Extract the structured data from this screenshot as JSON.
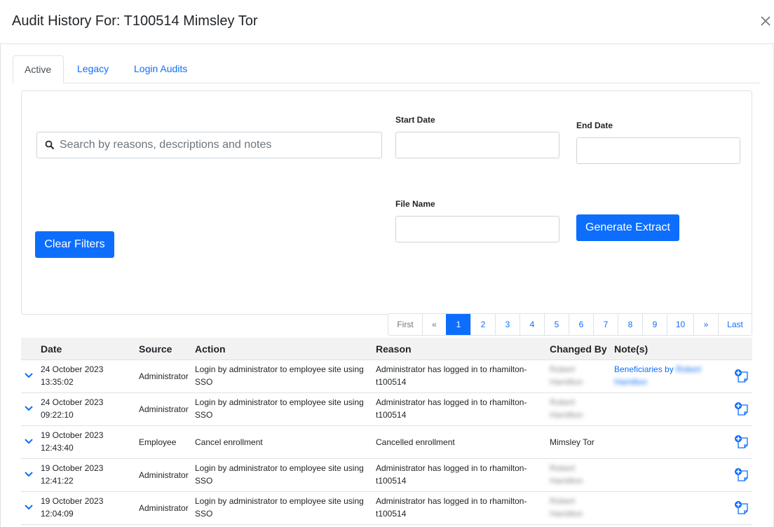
{
  "modal": {
    "title": "Audit History For: T100514 Mimsley Tor",
    "close_label": "×"
  },
  "tabs": [
    {
      "label": "Active",
      "active": true
    },
    {
      "label": "Legacy",
      "active": false
    },
    {
      "label": "Login Audits",
      "active": false
    }
  ],
  "filters": {
    "search_placeholder": "Search by reasons, descriptions and notes",
    "search_value": "",
    "start_date_label": "Start Date",
    "start_date_value": "",
    "end_date_label": "End Date",
    "end_date_value": "",
    "file_name_label": "File Name",
    "file_name_value": "",
    "clear_button": "Clear Filters",
    "generate_button": "Generate Extract"
  },
  "pagination": {
    "items": [
      "First",
      "«",
      "1",
      "2",
      "3",
      "4",
      "5",
      "6",
      "7",
      "8",
      "9",
      "10",
      "»",
      "Last"
    ],
    "active_page": "1"
  },
  "table": {
    "headers": [
      "Date",
      "Source",
      "Action",
      "Reason",
      "Changed By",
      "Note(s)"
    ],
    "rows": [
      {
        "date_1": "24 October 2023",
        "date_2": "13:35:02",
        "source": "Administrator",
        "action_1": "Login by administrator to employee site using",
        "action_2": "SSO",
        "reason_1": "Administrator has logged in to rhamilton-",
        "reason_2": "t100514",
        "changed_by_1": "Robert",
        "changed_by_2": "Hamilton",
        "note_1": "Beneficiaries by",
        "note_blur_1": "Robert",
        "note_blur_2": "Hamilton"
      },
      {
        "date_1": "24 October 2023",
        "date_2": "09:22:10",
        "source": "Administrator",
        "action_1": "Login by administrator to employee site using",
        "action_2": "SSO",
        "reason_1": "Administrator has logged in to rhamilton-",
        "reason_2": "t100514",
        "changed_by_1": "Robert",
        "changed_by_2": "Hamilton"
      },
      {
        "date_1": "19 October 2023",
        "date_2": "12:43:40",
        "source": "Employee",
        "action_1": "Cancel enrollment",
        "action_2": "",
        "reason_1": "Cancelled enrollment",
        "reason_2": "",
        "changed_by_1": "Mimsley Tor",
        "changed_by_2": ""
      },
      {
        "date_1": "19 October 2023",
        "date_2": "12:41:22",
        "source": "Administrator",
        "action_1": "Login by administrator to employee site using",
        "action_2": "SSO",
        "reason_1": "Administrator has logged in to rhamilton-",
        "reason_2": "t100514",
        "changed_by_1": "Robert",
        "changed_by_2": "Hamilton"
      },
      {
        "date_1": "19 October 2023",
        "date_2": "12:04:09",
        "source": "Administrator",
        "action_1": "Login by administrator to employee site using",
        "action_2": "SSO",
        "reason_1": "Administrator has logged in to rhamilton-",
        "reason_2": "t100514",
        "changed_by_1": "Robert",
        "changed_by_2": "Hamilton"
      }
    ]
  },
  "colors": {
    "primary": "#0d6efd",
    "border": "#dee2e6",
    "header_bg": "#f2f2f2"
  }
}
